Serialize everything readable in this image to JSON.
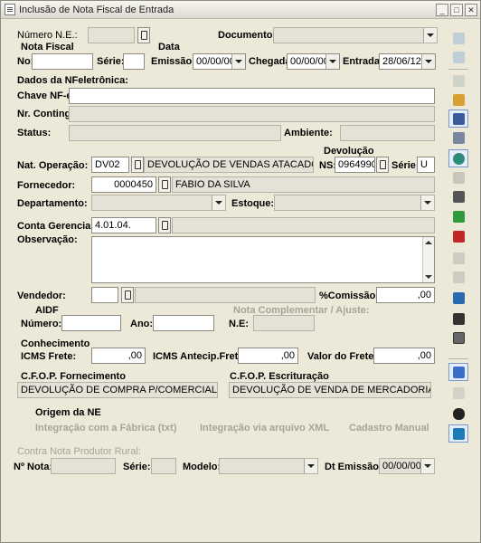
{
  "window": {
    "title": "Inclusão de Nota Fiscal de Entrada"
  },
  "header": {
    "numero_ne_label": "Número N.E.:",
    "documento_label": "Documento:",
    "nota_fiscal_label": "Nota Fiscal",
    "data_label": "Data",
    "no_label": "No:",
    "serie_label": "Série:",
    "emissao_label": "Emissão:",
    "emissao_value": "00/00/00",
    "chegada_label": "Chegada:",
    "chegada_value": "00/00/00",
    "entrada_label": "Entrada:",
    "entrada_value": "28/06/12"
  },
  "nfe": {
    "section_label": "Dados da NFeletrônica:",
    "chave_label": "Chave NF-e:",
    "conting_label": "Nr. Conting.:",
    "status_label": "Status:",
    "ambiente_label": "Ambiente:"
  },
  "operacao": {
    "devolucao_label": "Devolução",
    "nat_operacao_label": "Nat. Operação:",
    "nat_code": "DV02",
    "nat_desc": "DEVOLUÇÃO DE VENDAS ATACADO",
    "ns_label": "NS:",
    "ns_value": "0964990",
    "serie_label": "Série:",
    "serie_value": "U",
    "fornecedor_label": "Fornecedor:",
    "fornecedor_code": "0000450",
    "fornecedor_name": "FABIO DA SILVA",
    "departamento_label": "Departamento:",
    "estoque_label": "Estoque:",
    "conta_label": "Conta Gerencial:",
    "conta_value": "4.01.04.",
    "observacao_label": "Observação:",
    "vendedor_label": "Vendedor:",
    "comissao_label": "%Comissão:",
    "comissao_value": ",00"
  },
  "aidf": {
    "title": "AIDF",
    "numero_label": "Número:",
    "ano_label": "Ano:",
    "nota_complementar_label": "Nota Complementar / Ajuste:",
    "ne_label": "N.E:"
  },
  "conhecimento": {
    "title": "Conhecimento",
    "icms_frete_label": "ICMS Frete:",
    "icms_frete_value": ",00",
    "icms_antecip_label": "ICMS Antecip.Frete:",
    "icms_antecip_value": ",00",
    "valor_frete_label": "Valor do Frete:",
    "valor_frete_value": ",00"
  },
  "cfop": {
    "fornecimento_label": "C.F.O.P. Fornecimento",
    "fornecimento_value": "DEVOLUÇÃO DE COMPRA P/COMERCIALIZAÇ",
    "escrituracao_label": "C.F.O.P. Escrituração",
    "escrituracao_value": "DEVOLUÇÃO DE VENDA DE MERCADORIAAD"
  },
  "origem": {
    "title": "Origem da NE",
    "option1": "Integração com a Fábrica (txt)",
    "option2": "Integração via arquivo XML",
    "option3": "Cadastro Manual"
  },
  "contra_nota": {
    "title": "Contra Nota Produtor Rural:",
    "no_nota_label": "Nº Nota:",
    "serie_label": "Série:",
    "modelo_label": "Modelo:",
    "dt_emissao_label": "Dt Emissão:",
    "dt_emissao_value": "00/00/00"
  },
  "colors": {
    "window_bg": "#ece9d8",
    "disabled_text": "#a6a498",
    "field_readonly": "#e4e2d6"
  },
  "toolbar_icons": [
    "new-record-icon",
    "copy-record-icon",
    "print-preview-icon",
    "item-list-icon",
    "notes-icon",
    "flash-icon",
    "search-icon",
    "delete-icon",
    "stock-icon",
    "green-book-icon",
    "red-report-icon",
    "print-icon",
    "export-icon",
    "export-green-icon",
    "video-camera-icon",
    "calculator-icon",
    "import-icon",
    "folder-icon",
    "binoculars-icon",
    "exit-icon"
  ]
}
